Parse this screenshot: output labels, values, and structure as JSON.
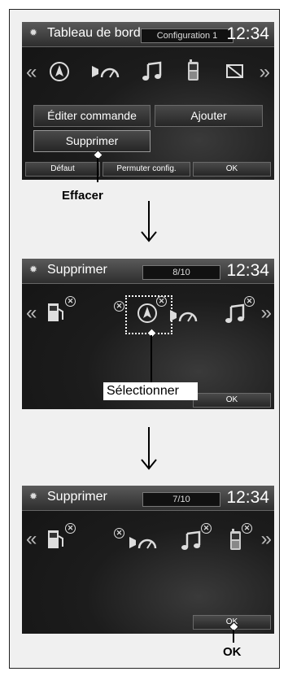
{
  "screen1": {
    "title": "Tableau de bord",
    "config_label": "Configuration 1",
    "clock": "12:34",
    "buttons": {
      "edit": "Éditer commande",
      "add": "Ajouter",
      "delete": "Supprimer",
      "default": "Défaut",
      "swap": "Permuter config.",
      "ok": "OK"
    },
    "icons": [
      "compass-icon",
      "speedometer-icon",
      "music-note-icon",
      "phone-icon",
      "no-display-icon"
    ]
  },
  "callout1": "Effacer",
  "screen2": {
    "title": "Supprimer",
    "count": "8/10",
    "clock": "12:34",
    "ok": "OK",
    "icons": [
      "fuel-icon",
      "compass-icon",
      "speedometer-icon",
      "music-note-icon"
    ]
  },
  "callout2": "Sélectionner",
  "screen3": {
    "title": "Supprimer",
    "count": "7/10",
    "clock": "12:34",
    "ok": "OK",
    "icons": [
      "fuel-icon",
      "speedometer-icon",
      "music-note-icon",
      "phone-icon"
    ]
  },
  "callout3": "OK"
}
